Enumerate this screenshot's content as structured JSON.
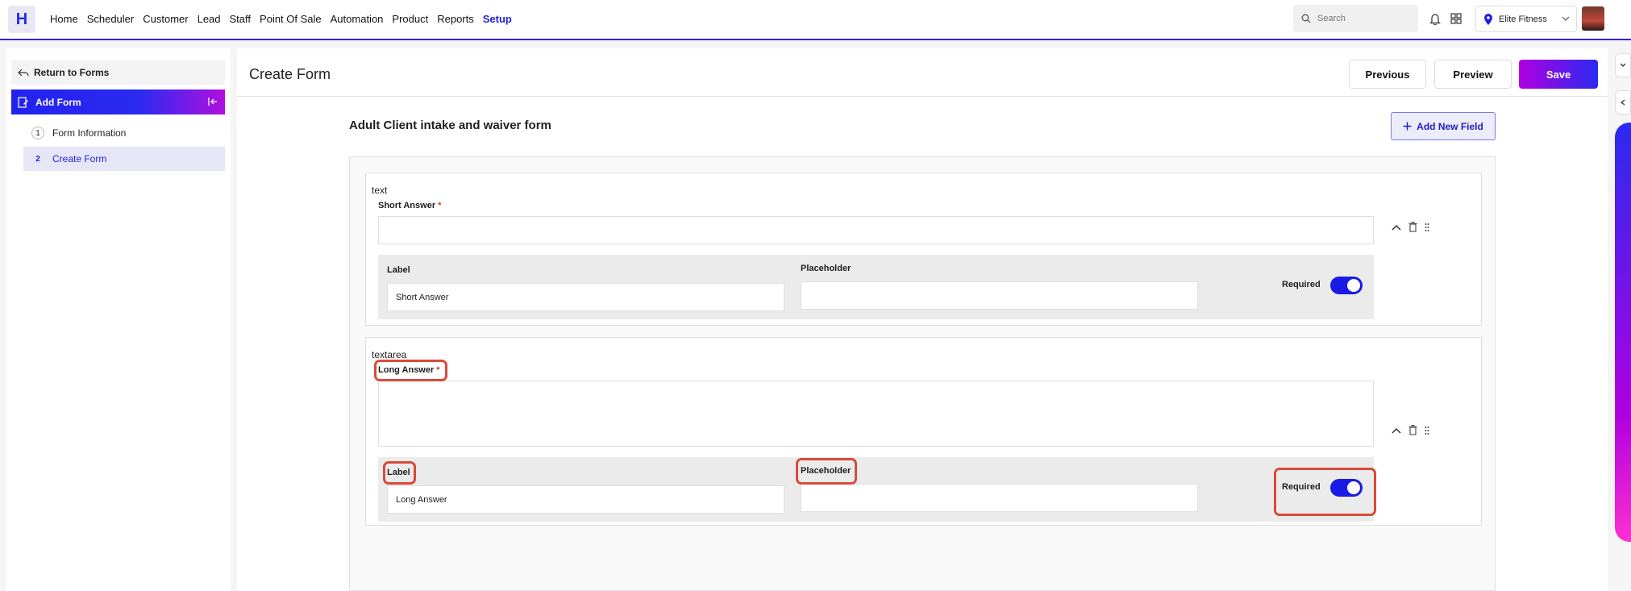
{
  "app": {
    "logo": "H"
  },
  "nav": {
    "items": [
      "Home",
      "Scheduler",
      "Customer",
      "Lead",
      "Staff",
      "Point Of Sale",
      "Automation",
      "Product",
      "Reports",
      "Setup"
    ],
    "active": "Setup"
  },
  "header": {
    "search_placeholder": "Search",
    "location": "Elite Fitness"
  },
  "sidebar": {
    "return_label": "Return to Forms",
    "add_form_label": "Add Form",
    "steps": [
      {
        "num": "1",
        "label": "Form Information"
      },
      {
        "num": "2",
        "label": "Create Form"
      }
    ]
  },
  "main": {
    "title": "Create Form",
    "previous_label": "Previous",
    "preview_label": "Preview",
    "save_label": "Save",
    "form_title": "Adult Client intake and waiver form",
    "add_field_label": "Add New Field"
  },
  "fields": [
    {
      "type": "text",
      "label": "Short Answer",
      "required_mark": "*",
      "label_prop": "Label",
      "label_value": "Short Answer",
      "placeholder_prop": "Placeholder",
      "placeholder_value": "",
      "required_label": "Required",
      "required": true
    },
    {
      "type": "textarea",
      "label": "Long Answer",
      "required_mark": "*",
      "label_prop": "Label",
      "label_value": "Long Answer",
      "placeholder_prop": "Placeholder",
      "placeholder_value": "",
      "required_label": "Required",
      "required": true
    }
  ],
  "colors": {
    "accent": "#1f1fe0",
    "highlight": "#d94a3a",
    "gradient_end": "#b000e0"
  }
}
